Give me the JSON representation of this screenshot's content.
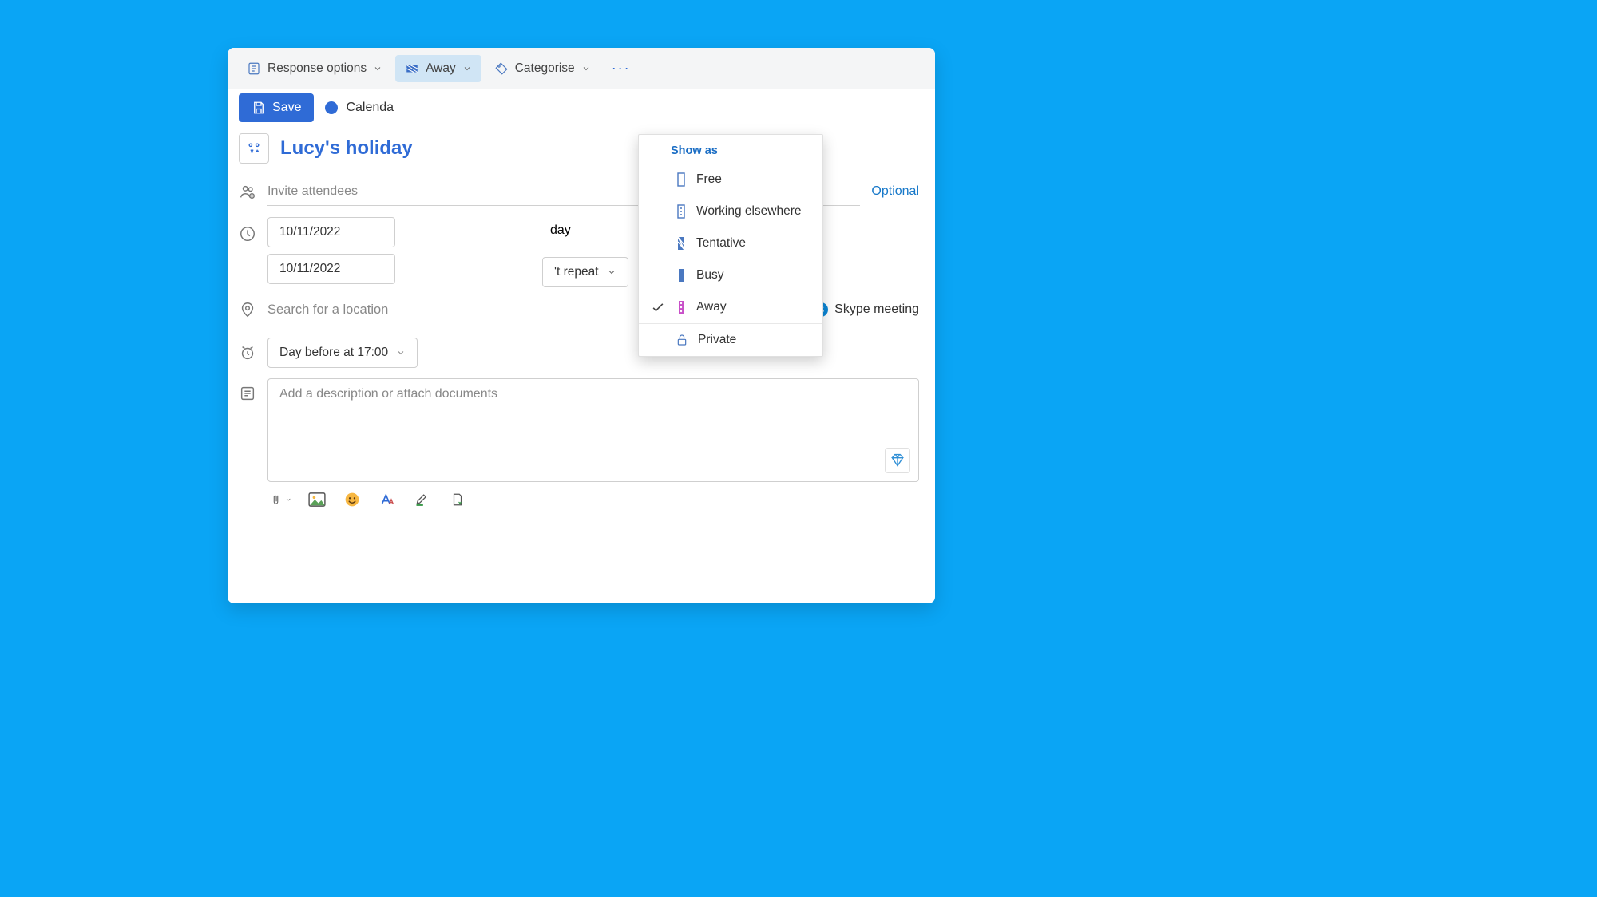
{
  "ribbon": {
    "response_options_label": "Response options",
    "show_as_label": "Away",
    "categorise_label": "Categorise"
  },
  "toolbar": {
    "save_label": "Save",
    "calendar_label": "Calenda"
  },
  "event": {
    "title": "Lucy's holiday",
    "attendees_placeholder": "Invite attendees",
    "optional_label": "Optional",
    "date_start": "10/11/2022",
    "date_end": "10/11/2022",
    "all_day_label": "day",
    "repeat_label": "'t repeat",
    "location_placeholder": "Search for a location",
    "skype_label": "Skype meeting",
    "reminder_label": "Day before at 17:00",
    "description_placeholder": "Add a description or attach documents"
  },
  "dropdown": {
    "header": "Show as",
    "items": [
      {
        "label": "Free",
        "selected": false,
        "key": "free"
      },
      {
        "label": "Working elsewhere",
        "selected": false,
        "key": "working-elsewhere"
      },
      {
        "label": "Tentative",
        "selected": false,
        "key": "tentative"
      },
      {
        "label": "Busy",
        "selected": false,
        "key": "busy"
      },
      {
        "label": "Away",
        "selected": true,
        "key": "away"
      }
    ],
    "private_label": "Private"
  }
}
